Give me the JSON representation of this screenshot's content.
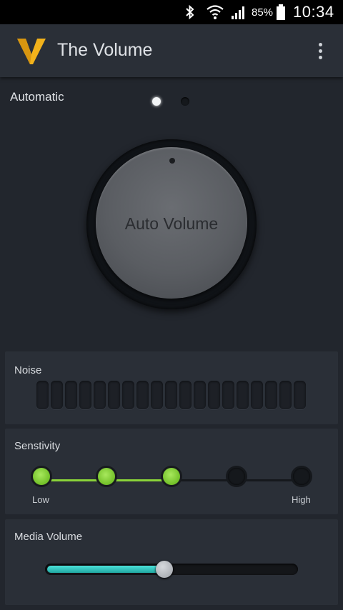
{
  "status_bar": {
    "battery_text": "85%",
    "clock": "10:34",
    "icons": [
      "bluetooth-icon",
      "wifi-icon",
      "signal-icon",
      "battery-icon"
    ]
  },
  "app_bar": {
    "title": "The Volume",
    "logo": "volume-v-logo",
    "logo_color": "#f2b21b",
    "menu_icon": "overflow-menu-icon"
  },
  "automatic": {
    "label": "Automatic",
    "pages": 2,
    "active_page": 0
  },
  "knob": {
    "label": "Auto Volume"
  },
  "noise": {
    "title": "Noise",
    "bar_count": 19,
    "active_bars": 0
  },
  "sensitivity": {
    "title": "Senstivity",
    "low_label": "Low",
    "high_label": "High",
    "steps": 5,
    "level": 3,
    "accent": "#8ad339"
  },
  "media_volume": {
    "title": "Media Volume",
    "value_fraction": 0.47,
    "accent": "#2fc4bd"
  }
}
